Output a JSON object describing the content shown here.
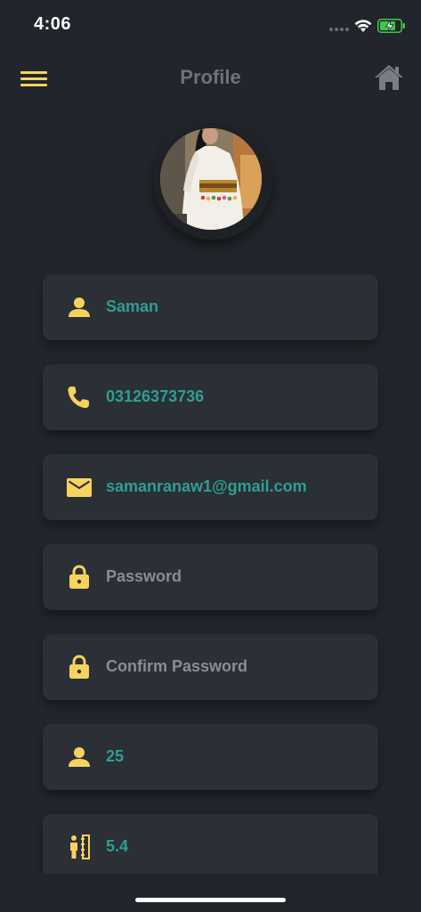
{
  "status_bar": {
    "time": "4:06",
    "icons": [
      "signal-dots-icon",
      "wifi-icon",
      "battery-charging-icon"
    ],
    "battery_color": "#3ec94b"
  },
  "header": {
    "title": "Profile",
    "menu_icon": "hamburger-menu-icon",
    "home_icon": "home-icon"
  },
  "avatar": {
    "icon": "profile-photo"
  },
  "fields": {
    "name": {
      "icon": "person-icon",
      "value": "Saman"
    },
    "phone": {
      "icon": "phone-icon",
      "value": "03126373736"
    },
    "email": {
      "icon": "mail-icon",
      "value": "samanranaw1@gmail.com"
    },
    "password": {
      "icon": "lock-icon",
      "placeholder": "Password"
    },
    "confirm_password": {
      "icon": "lock-icon",
      "placeholder": "Confirm Password"
    },
    "age": {
      "icon": "person-icon",
      "value": "25"
    },
    "height": {
      "icon": "height-ruler-icon",
      "value": "5.4"
    }
  },
  "colors": {
    "background": "#22252b",
    "field_background": "#2b2f36",
    "accent_yellow": "#f5d35e",
    "value_teal": "#2f9e93",
    "placeholder_gray": "#8a8d93",
    "title_gray": "#6f7278"
  }
}
